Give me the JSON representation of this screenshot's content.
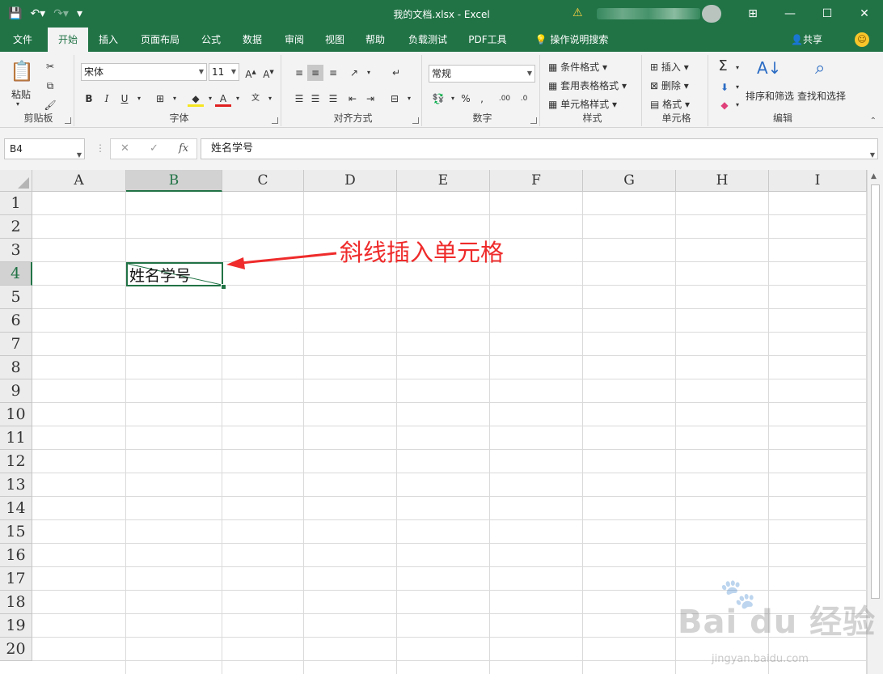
{
  "window": {
    "title": "我的文档.xlsx - Excel",
    "controls": {
      "ribbon_options": "⊞",
      "minimize": "—",
      "maximize": "☐",
      "close": "✕"
    }
  },
  "qat": {
    "save": "💾",
    "undo": "↶▾",
    "redo": "↷▾",
    "customize": "▾"
  },
  "tabs": [
    {
      "label": "文件"
    },
    {
      "label": "开始"
    },
    {
      "label": "插入"
    },
    {
      "label": "页面布局"
    },
    {
      "label": "公式"
    },
    {
      "label": "数据"
    },
    {
      "label": "审阅"
    },
    {
      "label": "视图"
    },
    {
      "label": "帮助"
    },
    {
      "label": "负载测试"
    },
    {
      "label": "PDF工具"
    },
    {
      "label": "操作说明搜索"
    }
  ],
  "share": "共享",
  "ribbon": {
    "clipboard": {
      "label": "剪贴板",
      "paste": "粘贴"
    },
    "font": {
      "label": "字体",
      "font_name": "宋体",
      "font_size": "11",
      "bold": "B",
      "italic": "I",
      "underline": "U"
    },
    "alignment": {
      "label": "对齐方式"
    },
    "number": {
      "label": "数字",
      "format": "常规"
    },
    "styles": {
      "label": "样式",
      "conditional": "条件格式",
      "table": "套用表格格式",
      "cell_styles": "单元格样式"
    },
    "cells": {
      "label": "单元格",
      "insert": "插入",
      "delete": "删除",
      "format": "格式"
    },
    "editing": {
      "label": "编辑",
      "sort": "排序和筛选",
      "find": "查找和选择"
    }
  },
  "formula_bar": {
    "name_box": "B4",
    "fx": "fx",
    "value": "姓名学号"
  },
  "columns": [
    "A",
    "B",
    "C",
    "D",
    "E",
    "F",
    "G",
    "H",
    "I"
  ],
  "rows": [
    "1",
    "2",
    "3",
    "4",
    "5",
    "6",
    "7",
    "8",
    "9",
    "10",
    "11",
    "12",
    "13",
    "14",
    "15",
    "16",
    "17",
    "18",
    "19",
    "20"
  ],
  "active_cell": {
    "ref": "B4",
    "text": "姓名学号"
  },
  "annotation": "斜线插入单元格",
  "watermark": {
    "main": "Bai du 经验",
    "sub": "jingyan.baidu.com"
  },
  "colors": {
    "excel_green": "#217346",
    "annotation_red": "#ef2b2b"
  }
}
